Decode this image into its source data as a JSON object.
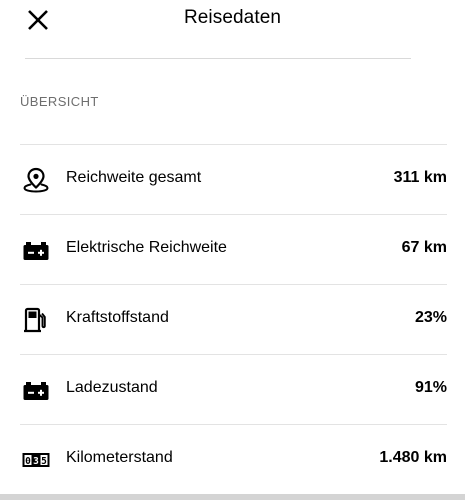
{
  "header": {
    "title": "Reisedaten",
    "close_icon": "close-icon"
  },
  "overview": {
    "section_label": "ÜBERSICHT",
    "rows": [
      {
        "icon": "location-pin-icon",
        "label": "Reichweite gesamt",
        "value": "311 km"
      },
      {
        "icon": "battery-icon",
        "label": "Elektrische Reichweite",
        "value": "67 km"
      },
      {
        "icon": "fuel-pump-icon",
        "label": "Kraftstoffstand",
        "value": "23%"
      },
      {
        "icon": "battery-icon",
        "label": "Ladezustand",
        "value": "91%"
      },
      {
        "icon": "odometer-icon",
        "label": "Kilometerstand",
        "value": "1.480 km"
      }
    ]
  },
  "odometer_icon_digits": [
    "0",
    "3",
    "5"
  ]
}
